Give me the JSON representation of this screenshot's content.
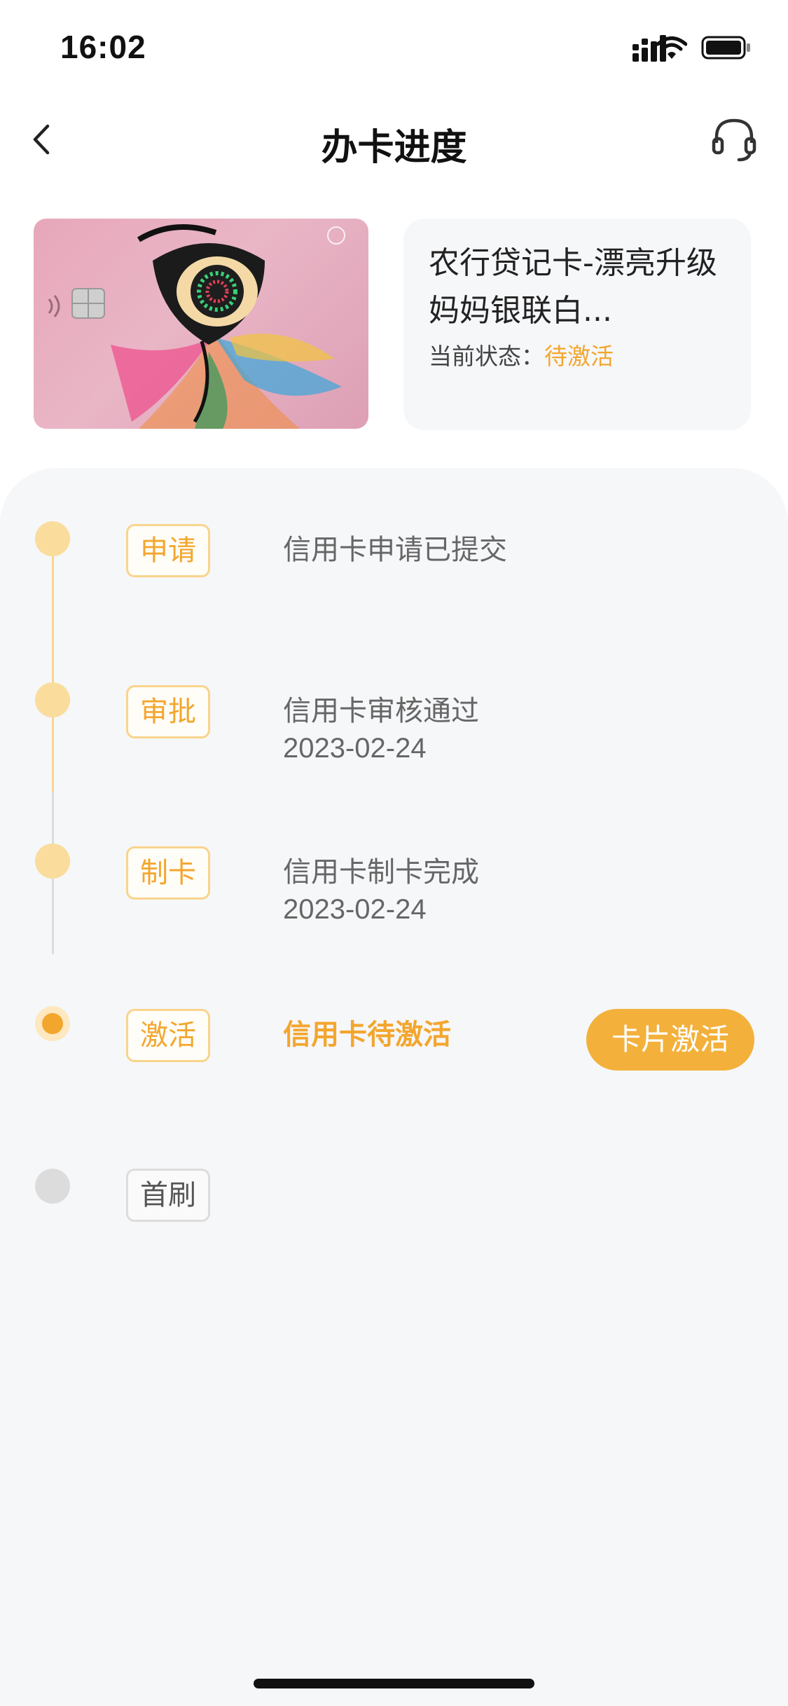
{
  "status_bar": {
    "time": "16:02"
  },
  "nav": {
    "title": "办卡进度"
  },
  "card": {
    "name": "农行贷记卡-漂亮升级妈妈银联白...",
    "status_label": "当前状态：",
    "status_value": "待激活"
  },
  "steps": [
    {
      "tag": "申请",
      "title": "信用卡申请已提交",
      "date": "",
      "state": "done"
    },
    {
      "tag": "审批",
      "title": "信用卡审核通过",
      "date": "2023-02-24",
      "state": "done"
    },
    {
      "tag": "制卡",
      "title": "信用卡制卡完成",
      "date": "2023-02-24",
      "state": "done"
    },
    {
      "tag": "激活",
      "title": "信用卡待激活",
      "date": "",
      "state": "current",
      "action": "卡片激活"
    },
    {
      "tag": "首刷",
      "title": "",
      "date": "",
      "state": "todo"
    }
  ],
  "colors": {
    "accent": "#f3a62e",
    "accent_light": "#f9d48c",
    "button": "#f3b13b",
    "inactive": "#dcdcdc",
    "panel_bg": "#f6f7f9"
  },
  "icons": {
    "back": "chevron-left-icon",
    "service": "headset-icon",
    "signal": "cellular-signal-icon",
    "wifi": "wifi-icon",
    "battery": "battery-icon"
  }
}
